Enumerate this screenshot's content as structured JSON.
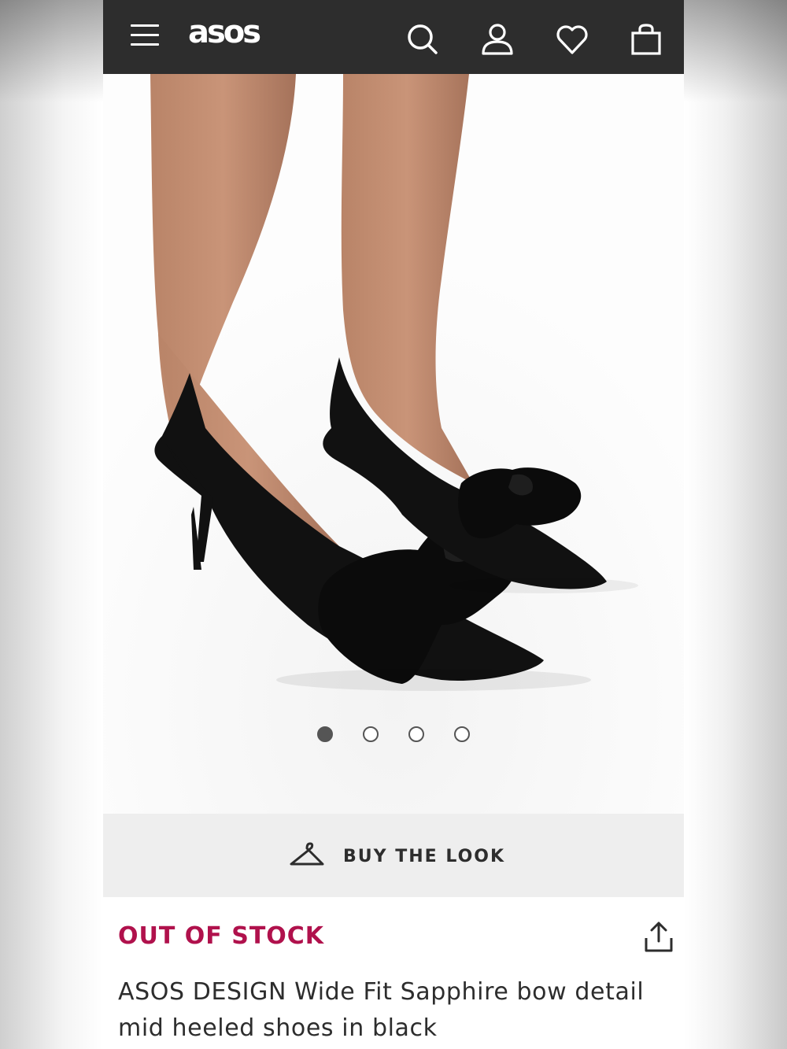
{
  "header": {
    "logo_text": "asos",
    "icons": [
      "menu-icon",
      "search-icon",
      "account-icon",
      "heart-icon",
      "bag-icon"
    ]
  },
  "gallery": {
    "image_count": 4,
    "active_index": 0
  },
  "buy_the_look": {
    "label": "BUY THE LOOK",
    "icon": "hanger-icon"
  },
  "product": {
    "stock_status": "OUT OF STOCK",
    "name": "ASOS DESIGN Wide Fit Sapphire bow detail mid heeled shoes in black",
    "share_icon": "share-icon"
  },
  "colors": {
    "header_bg": "#2d2d2d",
    "stock_red": "#b0114c",
    "buy_look_bg": "#eeeeee"
  }
}
